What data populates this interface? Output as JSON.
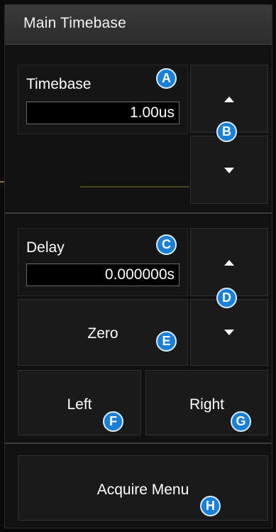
{
  "menu": {
    "title": "Main Timebase",
    "timebase": {
      "label": "Timebase",
      "value": "1.00us"
    },
    "delay": {
      "label": "Delay",
      "value": "0.000000s"
    },
    "buttons": {
      "zero": "Zero",
      "left": "Left",
      "right": "Right",
      "acquire_menu": "Acquire Menu"
    },
    "icons": {
      "increase": "up-arrow-icon",
      "decrease": "down-arrow-icon"
    }
  },
  "callouts": {
    "a": "A",
    "b": "B",
    "c": "C",
    "d": "D",
    "e": "E",
    "f": "F",
    "g": "G",
    "h": "H"
  },
  "colors": {
    "panel_bg": "#111111",
    "button_bg": "#1a1a1a",
    "title_bg": "#333333",
    "callout_blue": "#1a7fd6",
    "trace_yellow": "#b8a83a"
  }
}
